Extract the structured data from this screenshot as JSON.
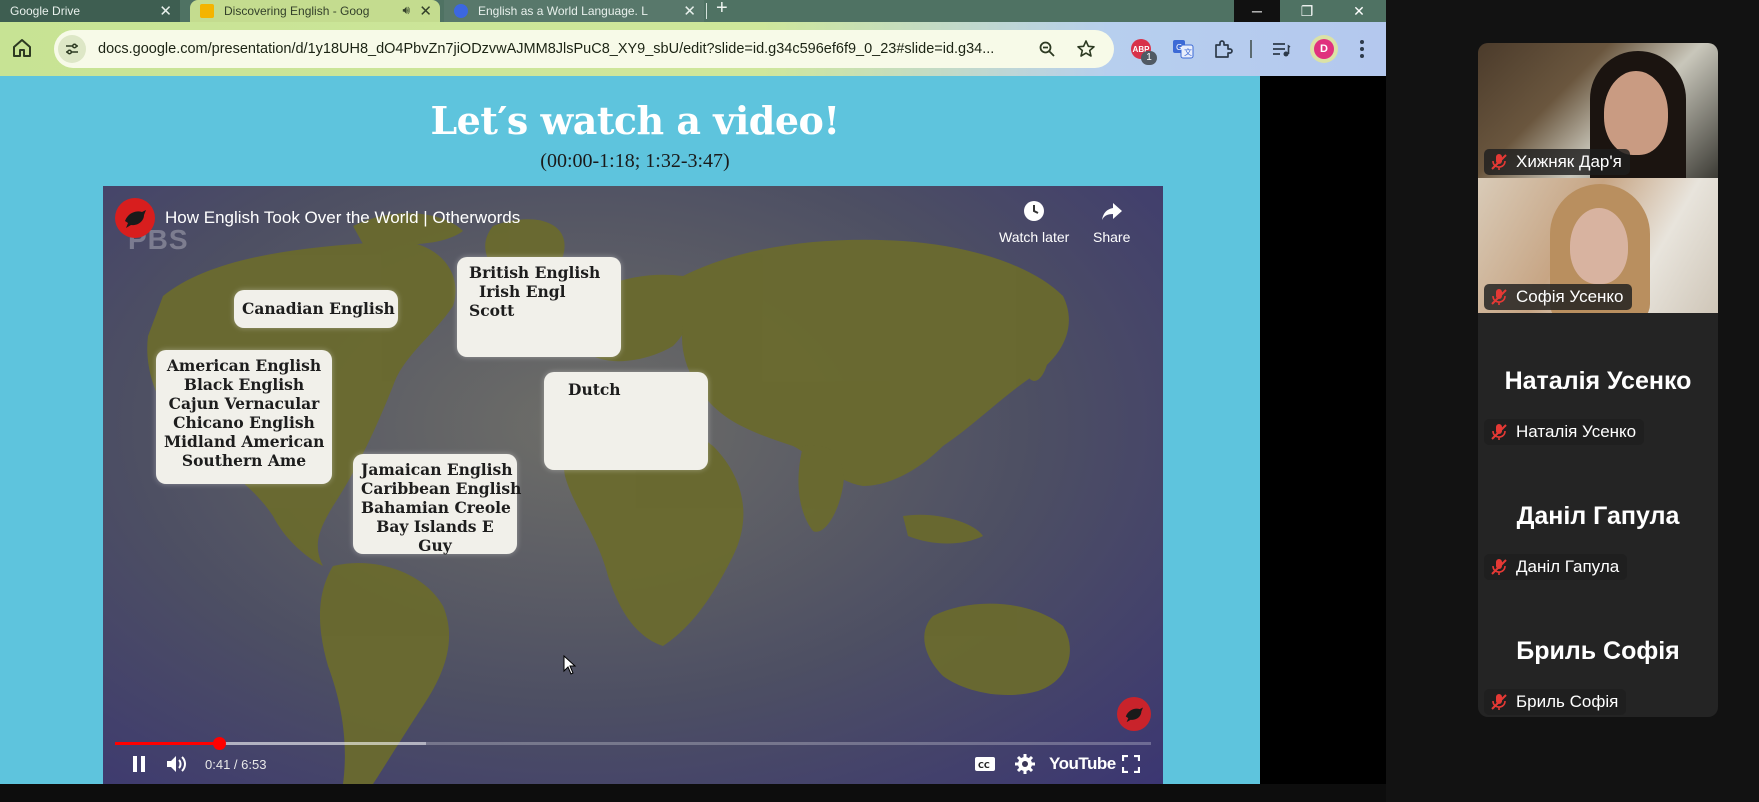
{
  "browser": {
    "tabs": [
      {
        "title": "Google Drive",
        "active": false
      },
      {
        "title": "Discovering English - Goog",
        "active": true
      },
      {
        "title": "English as a World Language. L",
        "active": false
      }
    ],
    "url": "docs.google.com/presentation/d/1y18UH8_dO4PbvZn7jiODzvwAJMM8JlsPuC8_XY9_sbU/edit?slide=id.g34c596ef6f9_0_23#slide=id.g34...",
    "extension_badge": "1",
    "profile_initial": "D"
  },
  "slide": {
    "title": "Let′s watch a video!",
    "subtitle": "(00:00-1:18; 1:32-3:47)",
    "background_color": "#5ec4dd"
  },
  "video": {
    "title": "How English Took Over the World | Otherwords",
    "watermark": "PBS",
    "watch_later_label": "Watch later",
    "share_label": "Share",
    "boxes": {
      "canadian": [
        "Canadian English"
      ],
      "british": [
        "British English",
        "Irish Engl",
        "Scott"
      ],
      "american": [
        "American English",
        "Black English",
        "Cajun Vernacular",
        "Chicano English",
        "Midland American",
        "Southern Ame"
      ],
      "dutch": [
        "Dutch"
      ],
      "jamaican": [
        "Jamaican English",
        "Caribbean English",
        "Bahamian Creole",
        "Bay Islands E",
        "Guy"
      ]
    },
    "time_display": "0:41 / 6:53",
    "progress_fraction": 0.1,
    "buffered_fraction": 0.3,
    "youtube_label": "YouTube",
    "accent_color": "#ff0000"
  },
  "participants": [
    {
      "name": "Хижняк Дар'я",
      "video": true,
      "muted": true
    },
    {
      "name": "Софія Усенко",
      "video": true,
      "muted": true
    },
    {
      "name": "Наталія Усенко",
      "video": false,
      "muted": true
    },
    {
      "name": "Даніл Гапула",
      "video": false,
      "muted": true
    },
    {
      "name": "Бриль Софія",
      "video": false,
      "muted": true
    }
  ],
  "icons": [
    "home-icon",
    "site-info-icon",
    "zoom-icon",
    "star-icon",
    "adblock-icon",
    "translate-icon",
    "puzzle-icon",
    "media-icon",
    "kebab-menu-icon",
    "clock-icon",
    "share-arrow-icon",
    "pause-icon",
    "volume-icon",
    "captions-icon",
    "gear-icon",
    "fullscreen-icon",
    "mic-off-icon"
  ]
}
